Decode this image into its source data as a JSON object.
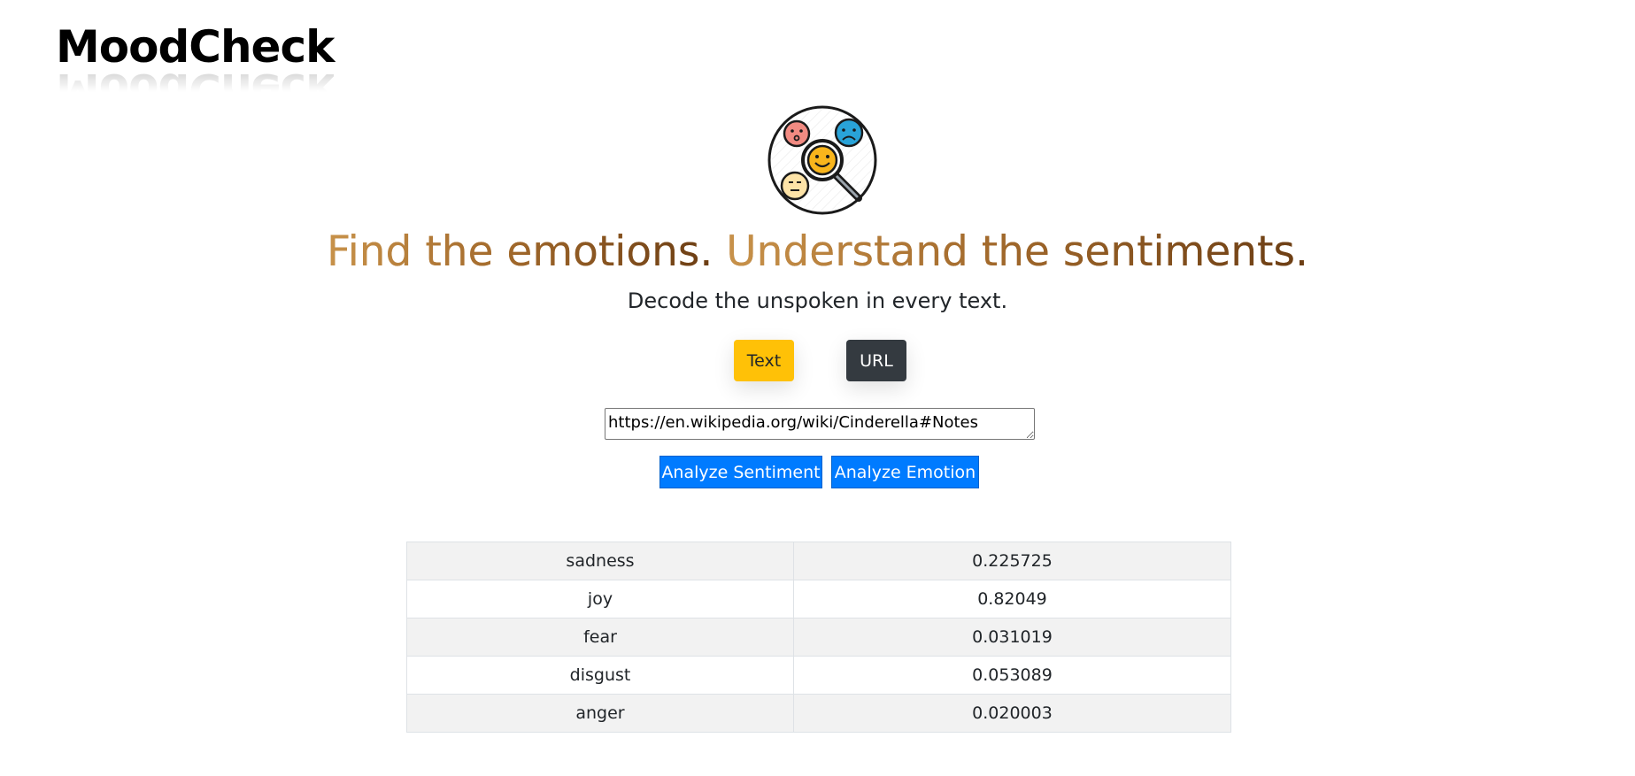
{
  "app": {
    "logo_text": "MoodCheck"
  },
  "hero": {
    "headline_part1": "Find the emotions.",
    "headline_part2": "Understand the sentiments.",
    "subheadline": "Decode the unspoken in every text."
  },
  "mode_toggle": {
    "text_label": "Text",
    "url_label": "URL",
    "selected": "Text"
  },
  "input": {
    "value": "https://en.wikipedia.org/wiki/Cinderella#Notes"
  },
  "actions": {
    "analyze_sentiment_label": "Analyze Sentiment",
    "analyze_emotion_label": "Analyze Emotion"
  },
  "results": {
    "rows": [
      {
        "emotion": "sadness",
        "score": "0.225725"
      },
      {
        "emotion": "joy",
        "score": "0.82049"
      },
      {
        "emotion": "fear",
        "score": "0.031019"
      },
      {
        "emotion": "disgust",
        "score": "0.053089"
      },
      {
        "emotion": "anger",
        "score": "0.020003"
      }
    ]
  },
  "colors": {
    "text_button": "#ffc107",
    "url_button": "#343a40",
    "action_button": "#007bff",
    "headline_start": "#c48e44",
    "headline_end": "#6f4116",
    "table_stripe": "#f2f2f2"
  }
}
